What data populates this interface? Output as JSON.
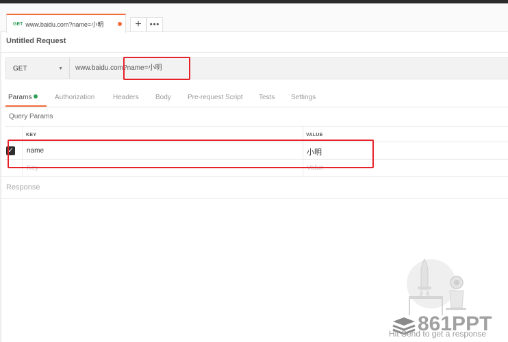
{
  "tab": {
    "method": "GET",
    "url": "www.baidu.com?name=小明",
    "new_tab_symbol": "+",
    "more_symbol": "•••",
    "dirty_color": "#f26b3a"
  },
  "request": {
    "title": "Untitled Request",
    "method": "GET",
    "url": "www.baidu.com?name=小明"
  },
  "subtabs": [
    {
      "label": "Params",
      "active": true
    },
    {
      "label": "Authorization"
    },
    {
      "label": "Headers"
    },
    {
      "label": "Body"
    },
    {
      "label": "Pre-request Script"
    },
    {
      "label": "Tests"
    },
    {
      "label": "Settings"
    }
  ],
  "params": {
    "section_label": "Query Params",
    "headers": {
      "key": "KEY",
      "value": "VALUE"
    },
    "rows": [
      {
        "checked": true,
        "key": "name",
        "value": "小明"
      }
    ],
    "placeholder": {
      "key": "Key",
      "value": "Value"
    }
  },
  "response": {
    "label": "Response",
    "empty_hint": "Hit Send to get a response"
  },
  "watermark": "861PPT",
  "colors": {
    "accent": "#f26b3a",
    "active_dot": "#2f9e58",
    "annotation": "#e8202a"
  },
  "icons": {
    "method_caret": "chevron-down-icon",
    "checkbox": "checkmark-icon",
    "illustration": "rocket-astronaut-icon"
  }
}
